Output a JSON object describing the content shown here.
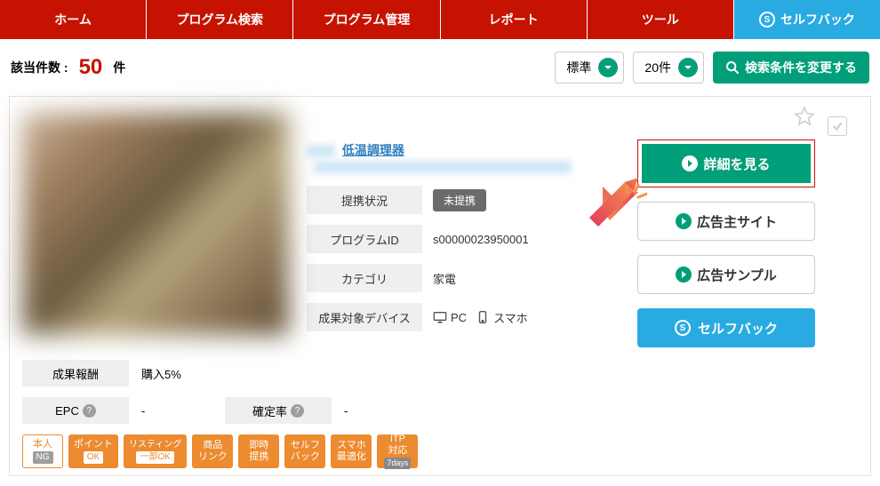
{
  "nav": {
    "home": "ホーム",
    "program_search": "プログラム検索",
    "program_manage": "プログラム管理",
    "report": "レポート",
    "tool": "ツール",
    "selfback": "セルフバック"
  },
  "results": {
    "label": "該当件数 :",
    "count": "50",
    "unit": "件"
  },
  "sort_select": "標準",
  "per_page_select": "20件",
  "change_search_btn": "検索条件を変更する",
  "program": {
    "link_text": "低温調理器",
    "fields": {
      "partner_label": "提携状況",
      "partner_status": "未提携",
      "id_label": "プログラムID",
      "id_value": "s00000023950001",
      "category_label": "カテゴリ",
      "category_value": "家電",
      "device_label": "成果対象デバイス",
      "device_pc": "PC",
      "device_sp": "スマホ"
    }
  },
  "actions": {
    "detail": "詳細を見る",
    "advertiser_site": "広告主サイト",
    "ad_sample": "広告サンプル",
    "selfback": "セルフバック"
  },
  "lower": {
    "reward_label": "成果報酬",
    "reward_value": "購入5%",
    "epc_label": "EPC",
    "epc_value": "-",
    "confirm_label": "確定率",
    "confirm_value": "-"
  },
  "tags": {
    "self_top": "本人",
    "self_sub": "NG",
    "point_top": "ポイント",
    "point_sub": "OK",
    "listing_top": "リスティング",
    "listing_sub": "一部OK",
    "product_top": "商品",
    "product_bot": "リンク",
    "instant_top": "即時",
    "instant_bot": "提携",
    "selfb_top": "セルフ",
    "selfb_bot": "バック",
    "sp_top": "スマホ",
    "sp_bot": "最適化",
    "itp_top": "ITP",
    "itp_mid": "対応",
    "itp_sub": "7days"
  }
}
